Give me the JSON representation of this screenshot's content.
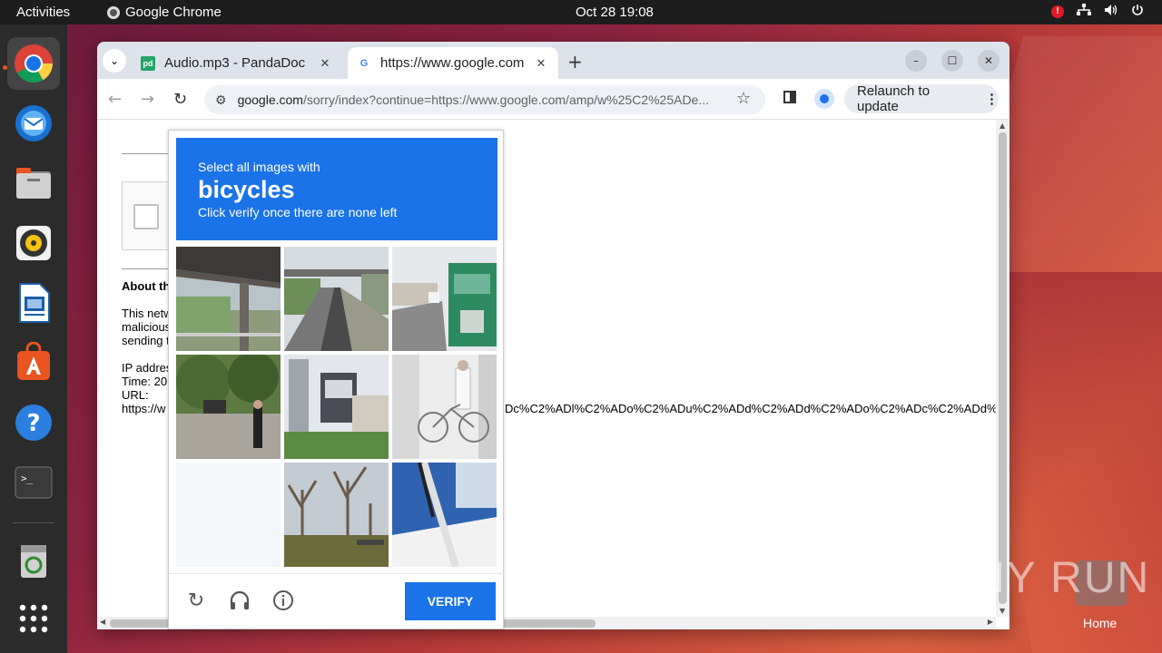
{
  "topbar": {
    "activities": "Activities",
    "app_name": "Google Chrome",
    "clock": "Oct 28  19:08",
    "alert_badge": "!"
  },
  "dock": {
    "items": [
      "chrome-icon",
      "thunderbird-icon",
      "files-icon",
      "rhythmbox-icon",
      "libreoffice-impress-icon",
      "app-center-icon",
      "help-icon",
      "terminal-icon",
      "trash-icon",
      "show-apps-icon"
    ]
  },
  "browser": {
    "tabs": [
      {
        "title": "Audio.mp3 - PandaDoc",
        "favicon": "pd"
      },
      {
        "title": "https://www.google.com",
        "favicon": "G"
      }
    ],
    "new_tab": "+",
    "url_host": "google.com",
    "url_path": "/sorry/index?continue=https://www.google.com/amp/w%25C2%25ADe...",
    "relaunch_label": "Relaunch to update"
  },
  "page": {
    "about_heading": "About th",
    "para_lines": [
      "This netw",
      "malicious",
      "sending t"
    ],
    "ip_lines": [
      "IP addres",
      "Time: 20",
      "URL:",
      "https://w"
    ],
    "url_tail": "Dc%C2%ADl%C2%ADo%C2%ADu%C2%ADd%C2%ADd%C2%ADo%C2%ADc%C2%ADd%"
  },
  "captcha": {
    "line1": "Select all images with",
    "target": "bicycles",
    "line3": "Click verify once there are none left",
    "verify_label": "VERIFY",
    "tiles": [
      {
        "name": "underpass"
      },
      {
        "name": "road-overpass"
      },
      {
        "name": "green-truck"
      },
      {
        "name": "street-people"
      },
      {
        "name": "city-bridge"
      },
      {
        "name": "cyclist"
      },
      {
        "name": "blank"
      },
      {
        "name": "bare-trees"
      },
      {
        "name": "boat-rail"
      }
    ]
  },
  "watermark": {
    "text": "ANY  RUN",
    "home_label": "Home"
  }
}
